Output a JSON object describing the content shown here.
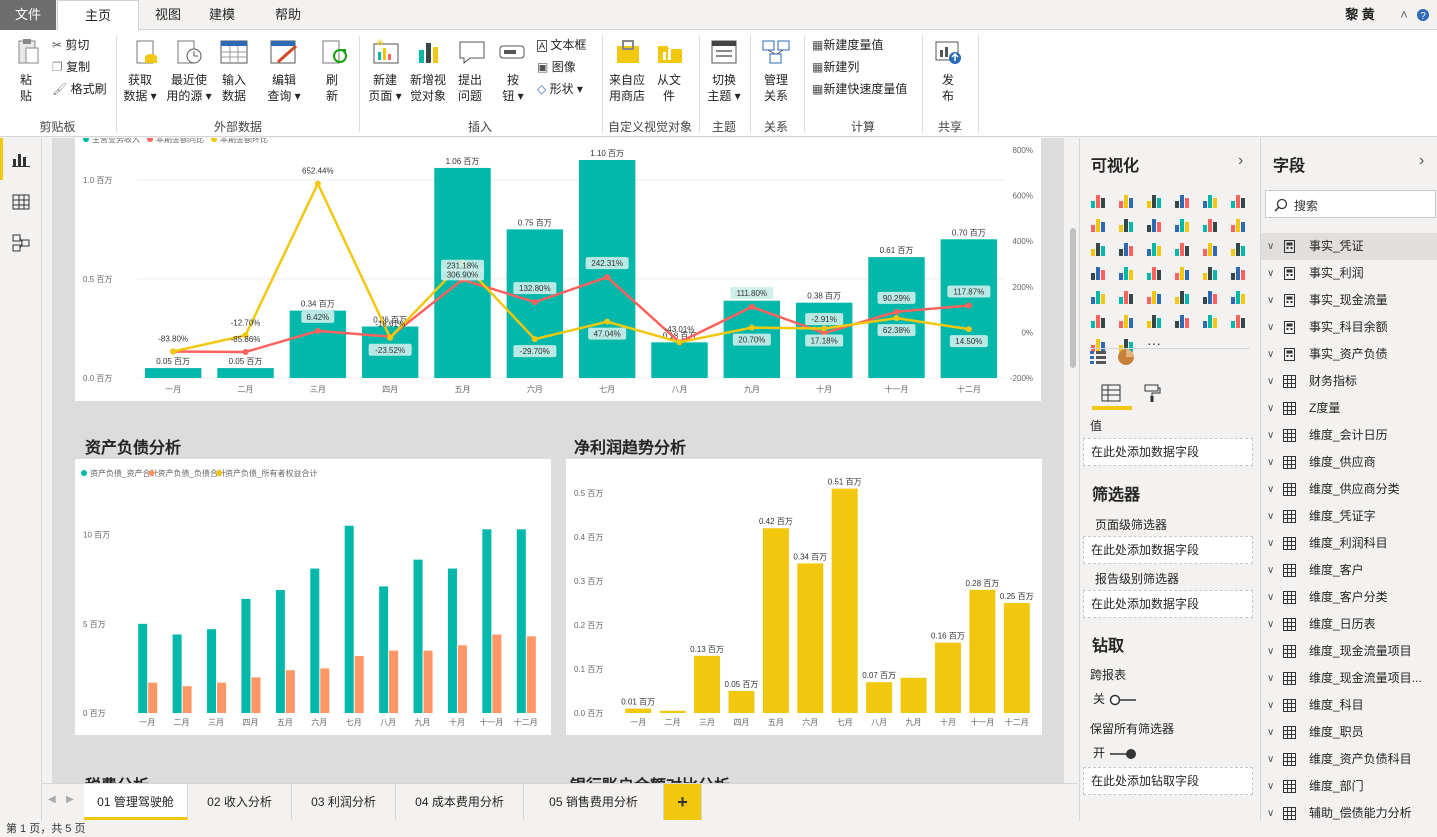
{
  "menubar": {
    "tabs": [
      "文件",
      "主页",
      "视图",
      "建模",
      "帮助"
    ],
    "user": "黎 黄",
    "collapse_icon": "chevron-up-icon",
    "help_icon": "help-icon"
  },
  "ribbon": {
    "clipboard": {
      "paste": [
        "粘",
        "贴"
      ],
      "cut": "剪切",
      "copy": "复制",
      "format_painter": "格式刷",
      "group": "剪贴板"
    },
    "external": {
      "get_data": [
        "获取",
        "数据 ▾"
      ],
      "recent": [
        "最近使",
        "用的源 ▾"
      ],
      "enter": [
        "输入",
        "数据"
      ],
      "edit": [
        "编辑",
        "查询 ▾"
      ],
      "refresh": [
        "刷",
        "新"
      ],
      "group": "外部数据"
    },
    "insert": {
      "new_page": [
        "新建",
        "页面 ▾"
      ],
      "new_visual": [
        "新增视",
        "觉对象"
      ],
      "ask": [
        "提出",
        "问题"
      ],
      "buttons": [
        "按",
        "钮 ▾"
      ],
      "textbox": "文本框",
      "image": "图像",
      "shapes": "形状 ▾",
      "group": "插入"
    },
    "custom": {
      "marketplace": [
        "来自应",
        "用商店"
      ],
      "from_file": [
        "从文",
        "件"
      ],
      "group": "自定义视觉对象"
    },
    "themes": {
      "switch": [
        "切换",
        "主题 ▾"
      ],
      "group": "主题"
    },
    "relations": {
      "manage": [
        "管理",
        "关系"
      ],
      "group": "关系"
    },
    "calc": {
      "new_measure": "新建度量值",
      "new_column": "新建列",
      "quick_measure": "新建快速度量值",
      "group": "计算"
    },
    "share": {
      "publish": [
        "发",
        "布"
      ],
      "group": "共享"
    }
  },
  "visuals": {
    "top": {
      "legend": [
        "主营业务收入",
        "本期金额同比",
        "本期金额环比"
      ],
      "months": [
        "一月",
        "二月",
        "三月",
        "四月",
        "五月",
        "六月",
        "七月",
        "八月",
        "九月",
        "十月",
        "十一月",
        "十二月"
      ],
      "bar_labels": [
        "0.05 百万",
        "0.05 百万",
        "0.34 百万",
        "0.26 百万",
        "1.06 百万",
        "0.75 百万",
        "1.10 百万",
        "0.18 百万",
        "0.39 百万",
        "0.38 百万",
        "0.61 百万",
        "0.70 百万"
      ],
      "yoy_labels": [
        "-83.80%",
        "-85.86%",
        "6.42%",
        "-18.61%",
        "231.18%",
        "132.80%",
        "242.31%",
        "-43.01%",
        "111.80%",
        "-2.91%",
        "90.29%",
        "117.87%"
      ],
      "mom_labels": [
        "",
        "-12.70%",
        "652.44%",
        "-23.52%",
        "306.90%",
        "-29.70%",
        "47.04%",
        "",
        "20.70%",
        "17.18%",
        "62.38%",
        "14.50%"
      ],
      "left_ticks": [
        "1.0 百万",
        "0.5 百万",
        "0.0 百万"
      ],
      "right_ticks": [
        "800%",
        "600%",
        "400%",
        "200%",
        "0%",
        "-200%"
      ]
    },
    "balance": {
      "title": "资产负债分析",
      "legend": [
        "资产负债_资产合计",
        "资产负债_负债合计",
        "资产负债_所有者权益合计"
      ],
      "months": [
        "一月",
        "二月",
        "三月",
        "四月",
        "五月",
        "六月",
        "七月",
        "八月",
        "九月",
        "十月",
        "十一月",
        "十二月"
      ],
      "ticks": [
        "10 百万",
        "5 百万",
        "0 百万"
      ]
    },
    "profit": {
      "title": "净利润趋势分析",
      "months": [
        "一月",
        "二月",
        "三月",
        "四月",
        "五月",
        "六月",
        "七月",
        "八月",
        "九月",
        "十月",
        "十一月",
        "十二月"
      ],
      "labels": [
        "0.01 百万",
        "",
        "0.13 百万",
        "0.05 百万",
        "0.42 百万",
        "0.34 百万",
        "0.51 百万",
        "0.07 百万",
        "",
        "0.16 百万",
        "0.28 百万",
        "0.25 百万"
      ],
      "ticks": [
        "0.5 百万",
        "0.4 百万",
        "0.3 百万",
        "0.2 百万",
        "0.1 百万",
        "0.0 百万"
      ]
    },
    "bottom_titles": [
      "税费分析",
      "银行账户余额对比分析"
    ]
  },
  "chart_data": [
    {
      "type": "bar",
      "title": "",
      "categories": [
        "一月",
        "二月",
        "三月",
        "四月",
        "五月",
        "六月",
        "七月",
        "八月",
        "九月",
        "十月",
        "十一月",
        "十二月"
      ],
      "series": [
        {
          "name": "主营业务收入",
          "values": [
            0.05,
            0.05,
            0.34,
            0.26,
            1.06,
            0.75,
            1.1,
            0.18,
            0.39,
            0.38,
            0.61,
            0.7
          ]
        },
        {
          "name": "本期金额同比",
          "values": [
            -83.8,
            -85.86,
            6.42,
            -18.61,
            231.18,
            132.8,
            242.31,
            -43.01,
            111.8,
            -2.91,
            90.29,
            117.87
          ]
        },
        {
          "name": "本期金额环比",
          "values": [
            -83.8,
            -12.7,
            652.44,
            -23.52,
            306.9,
            -29.7,
            47.04,
            -43.01,
            20.7,
            17.18,
            62.38,
            14.5
          ]
        }
      ],
      "ylim": [
        0,
        1.1
      ],
      "y2lim": [
        -200,
        800
      ]
    },
    {
      "type": "bar",
      "title": "资产负债分析",
      "categories": [
        "一月",
        "二月",
        "三月",
        "四月",
        "五月",
        "六月",
        "七月",
        "八月",
        "九月",
        "十月",
        "十一月",
        "十二月"
      ],
      "series": [
        {
          "name": "资产负债_资产合计",
          "values": [
            5.0,
            4.4,
            4.7,
            6.4,
            6.9,
            8.1,
            10.5,
            7.1,
            8.6,
            8.1,
            10.3,
            10.3
          ]
        },
        {
          "name": "资产负债_负债合计",
          "values": [
            1.7,
            1.5,
            1.7,
            2.0,
            2.4,
            2.5,
            3.2,
            3.5,
            3.5,
            3.8,
            4.4,
            4.3
          ]
        },
        {
          "name": "资产负债_所有者权益合计",
          "values": [
            0,
            0,
            0,
            0,
            0,
            0,
            0,
            0,
            0,
            0,
            0,
            0
          ]
        }
      ],
      "ylim": [
        0,
        12
      ]
    },
    {
      "type": "bar",
      "title": "净利润趋势分析",
      "categories": [
        "一月",
        "二月",
        "三月",
        "四月",
        "五月",
        "六月",
        "七月",
        "八月",
        "九月",
        "十月",
        "十一月",
        "十二月"
      ],
      "values": [
        0.01,
        0.005,
        0.13,
        0.05,
        0.42,
        0.34,
        0.51,
        0.07,
        0.08,
        0.16,
        0.28,
        0.25
      ],
      "ylim": [
        0,
        0.52
      ]
    }
  ],
  "pages": {
    "tabs": [
      "01 管理驾驶舱",
      "02 收入分析",
      "03 利润分析",
      "04 成本费用分析",
      "05 销售费用分析"
    ],
    "add": "+"
  },
  "status": "第 1 页，共 5 页",
  "viz": {
    "title": "可视化",
    "value_label": "值",
    "add_field": "在此处添加数据字段",
    "filters_title": "筛选器",
    "page_filters": "页面级筛选器",
    "report_filters": "报告级别筛选器",
    "drill_title": "钻取",
    "cross_report": "跨报表",
    "off": "关",
    "keep_filters": "保留所有筛选器",
    "on": "开",
    "add_drill": "在此处添加钻取字段"
  },
  "fields": {
    "title": "字段",
    "search_placeholder": "搜索",
    "items": [
      {
        "name": "事实_凭证",
        "icon": "calculator-icon"
      },
      {
        "name": "事实_利润",
        "icon": "calculator-icon"
      },
      {
        "name": "事实_现金流量",
        "icon": "calculator-icon"
      },
      {
        "name": "事实_科目余额",
        "icon": "calculator-icon"
      },
      {
        "name": "事实_资产负债",
        "icon": "calculator-icon"
      },
      {
        "name": "财务指标",
        "icon": "table-icon"
      },
      {
        "name": "Z度量",
        "icon": "table-icon"
      },
      {
        "name": "维度_会计日历",
        "icon": "table-icon"
      },
      {
        "name": "维度_供应商",
        "icon": "table-icon"
      },
      {
        "name": "维度_供应商分类",
        "icon": "table-icon"
      },
      {
        "name": "维度_凭证字",
        "icon": "table-icon"
      },
      {
        "name": "维度_利润科目",
        "icon": "table-icon"
      },
      {
        "name": "维度_客户",
        "icon": "table-icon"
      },
      {
        "name": "维度_客户分类",
        "icon": "table-icon"
      },
      {
        "name": "维度_日历表",
        "icon": "table-icon"
      },
      {
        "name": "维度_现金流量项目",
        "icon": "table-icon"
      },
      {
        "name": "维度_现金流量项目...",
        "icon": "table-icon"
      },
      {
        "name": "维度_科目",
        "icon": "table-icon"
      },
      {
        "name": "维度_职员",
        "icon": "table-icon"
      },
      {
        "name": "维度_资产负债科目",
        "icon": "table-icon"
      },
      {
        "name": "维度_部门",
        "icon": "table-icon"
      },
      {
        "name": "辅助_偿债能力分析",
        "icon": "table-icon"
      }
    ]
  },
  "colors": {
    "teal": "#01b8aa",
    "salmon": "#fd625e",
    "yellow": "#f2c80f",
    "orange": "#fe9666",
    "accent_yellow": "#f2c80f"
  }
}
